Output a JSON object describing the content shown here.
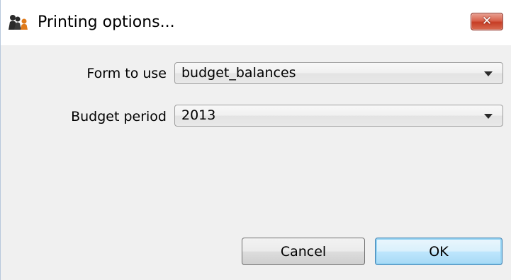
{
  "window": {
    "title": "Printing options...",
    "close_glyph": "✕",
    "app_icon": "people-icon"
  },
  "form": {
    "form_to_use": {
      "label": "Form to use",
      "value": "budget_balances"
    },
    "budget_period": {
      "label": "Budget period",
      "value": "2013"
    }
  },
  "buttons": {
    "cancel": "Cancel",
    "ok": "OK"
  },
  "colors": {
    "close_button": "#c63d25",
    "default_button_border": "#3c7fb1"
  }
}
